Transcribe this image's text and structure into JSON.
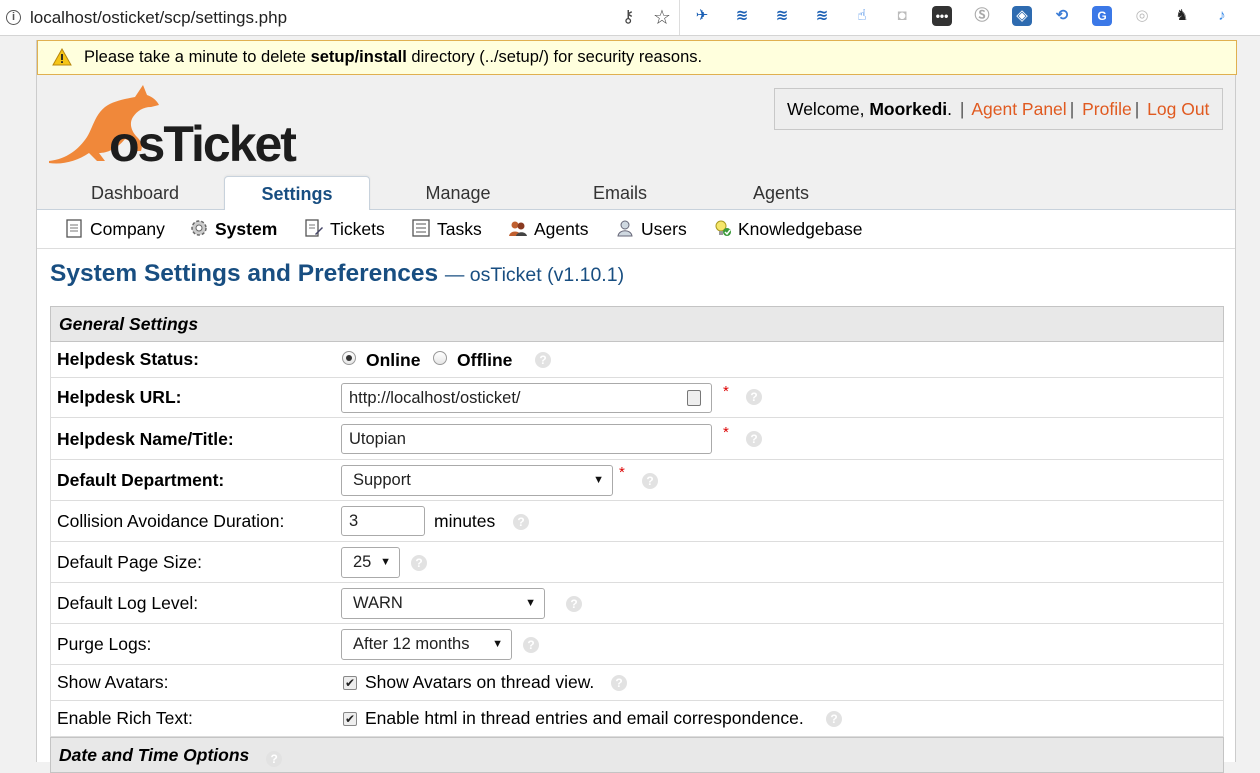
{
  "browser": {
    "url": "localhost/osticket/scp/settings.php"
  },
  "warning": {
    "prefix": "Please take a minute to delete ",
    "bold": "setup/install",
    "suffix": " directory (../setup/) for security reasons."
  },
  "logo": {
    "brand": "osTicket"
  },
  "user": {
    "welcome": "Welcome, ",
    "name": "Moorkedi",
    "after_name": ". ",
    "links": [
      "Agent Panel",
      "Profile",
      "Log Out"
    ],
    "separator": "|"
  },
  "tabs": [
    "Dashboard",
    "Settings",
    "Manage",
    "Emails",
    "Agents"
  ],
  "active_tab": "Settings",
  "subnav": [
    "Company",
    "System",
    "Tickets",
    "Tasks",
    "Agents",
    "Users",
    "Knowledgebase"
  ],
  "active_subnav": "System",
  "page": {
    "title": "System Settings and Preferences",
    "version": "— osTicket (v1.10.1)"
  },
  "sections": {
    "general": "General Settings",
    "datetime": "Date and Time Options"
  },
  "fields": {
    "helpdesk_status": {
      "label": "Helpdesk Status:",
      "options": [
        "Online",
        "Offline"
      ],
      "selected": "Online"
    },
    "helpdesk_url": {
      "label": "Helpdesk URL:",
      "value": "http://localhost/osticket/"
    },
    "helpdesk_name": {
      "label": "Helpdesk Name/Title:",
      "value": "Utopian"
    },
    "default_department": {
      "label": "Default Department:",
      "value": "Support"
    },
    "collision": {
      "label": "Collision Avoidance Duration:",
      "value": "3",
      "unit": "minutes"
    },
    "page_size": {
      "label": "Default Page Size:",
      "value": "25"
    },
    "log_level": {
      "label": "Default Log Level:",
      "value": "WARN"
    },
    "purge_logs": {
      "label": "Purge Logs:",
      "value": "After 12 months"
    },
    "show_avatars": {
      "label": "Show Avatars:",
      "checkbox_label": "Show Avatars on thread view.",
      "checked": true
    },
    "rich_text": {
      "label": "Enable Rich Text:",
      "checkbox_label": "Enable html in thread entries and email correspondence.",
      "checked": true
    }
  },
  "icons": {
    "required_mark": "*",
    "help": "?",
    "dropdown": "▼",
    "check": "✔"
  },
  "colors": {
    "brand_blue": "#184e81",
    "link_orange": "#e05a20",
    "warning_bg": "#ffffdd",
    "logo_orange": "#f0883a"
  }
}
